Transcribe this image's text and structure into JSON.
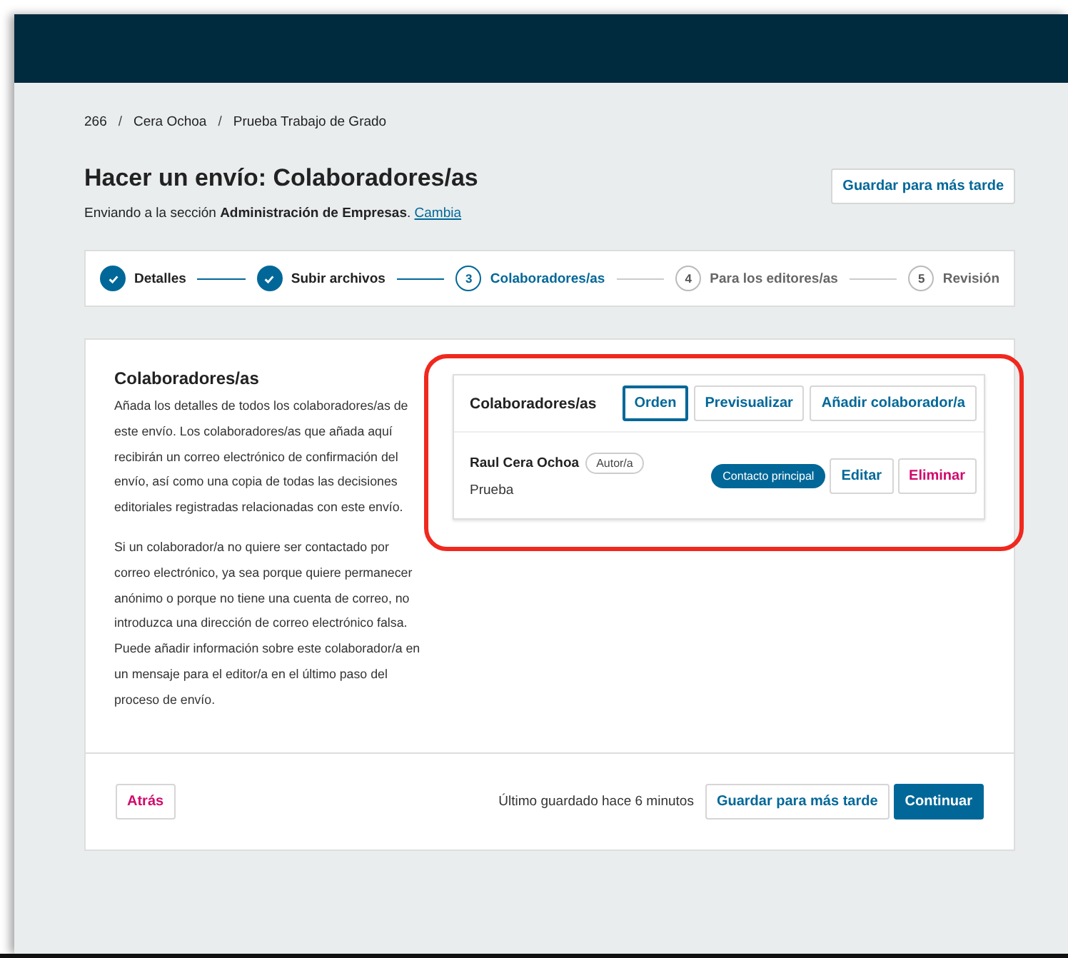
{
  "breadcrumb": [
    "266",
    "Cera Ochoa",
    "Prueba Trabajo de Grado"
  ],
  "breadcrumb_separator": "/",
  "page": {
    "title": "Hacer un envío: Colaboradores/as",
    "subtitle": "Enviando a la sección **Administración de Empresas**.",
    "change_link": "Cambia",
    "save_later": "Guardar para más tarde"
  },
  "steps": [
    {
      "label": "Detalles",
      "completed": true,
      "selected": false
    },
    {
      "label": "Subir archivos",
      "completed": true,
      "selected": false
    },
    {
      "number": "3",
      "label": "Colaboradores/as",
      "completed": false,
      "selected": true
    },
    {
      "number": "4",
      "label": "Para los editores/as",
      "completed": false,
      "selected": false
    },
    {
      "number": "5",
      "label": "Revisión",
      "completed": false,
      "selected": false
    }
  ],
  "section": {
    "title": "Colaboradores/as",
    "paragraphs": [
      "Añada los detalles de todos los colaboradores/as de este envío. Los colaboradores/as que añada aquí recibirán un correo electrónico de confirmación del envío, así como una copia de todas las decisiones editoriales registradas relacionadas con este envío.",
      "Si un colaborador/a no quiere ser contactado por correo electrónico, ya sea porque quiere permanecer anónimo o porque no tiene una cuenta de correo, no introduzca una dirección de correo electrónico falsa. Puede añadir información sobre este colaborador/a en un mensaje para el editor/a en el último paso del proceso de envío."
    ]
  },
  "contributors_panel": {
    "title": "Colaboradores/as",
    "highlighted": true,
    "buttons": [
      {
        "label": "Orden",
        "selected": true
      },
      {
        "label": "Previsualizar",
        "selected": false
      },
      {
        "label": "Añadir colaborador/a",
        "selected": false
      }
    ],
    "rows": [
      {
        "name": "Raul Cera Ochoa",
        "role": "Autor/a",
        "affiliation": "Prueba",
        "primary_contact": true,
        "primary_label": "Contacto principal",
        "edit": "Editar",
        "delete": "Eliminar"
      }
    ]
  },
  "footer": {
    "back": "Atrás",
    "last_saved": "Último guardado hace 6 minutos",
    "save_later": "Guardar para más tarde",
    "continue": "Continuar"
  }
}
